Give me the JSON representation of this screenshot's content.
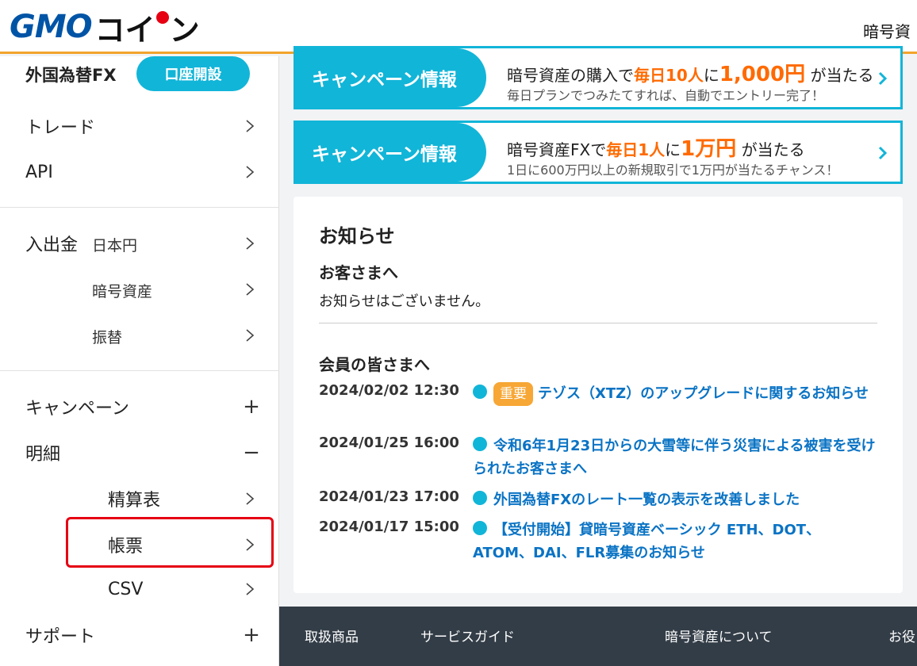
{
  "header": {
    "logo_gmo": "GMO",
    "logo_coin_a": "コイ",
    "logo_coin_b": "ン",
    "nav_cut": "暗号資"
  },
  "sidebar": {
    "fx_title": "外国為替FX",
    "open_account": "口座開設",
    "trade": "トレード",
    "api": "API",
    "deposit": "入出金",
    "deposit_jpy": "日本円",
    "deposit_crypto": "暗号資産",
    "transfer": "振替",
    "campaign": "キャンペーン",
    "statement": "明細",
    "statement_settlement": "精算表",
    "statement_report": "帳票",
    "statement_csv": "CSV",
    "support": "サポート",
    "plus": "+",
    "minus": "−"
  },
  "banners": [
    {
      "tag": "キャンペーン情報",
      "line1_a": "暗号資産の購入で",
      "line1_hl": "毎日10人",
      "line1_b": "に",
      "line1_big": "1,000円",
      "line1_c": "が当たる",
      "line2": "毎日プランでつみたてすれば、自動でエントリー完了！"
    },
    {
      "tag": "キャンペーン情報",
      "line1_a": "暗号資産FXで",
      "line1_hl": "毎日1人",
      "line1_b": "に",
      "line1_big": "1万円",
      "line1_c": "が当たる",
      "line2": "1日に600万円以上の新規取引で1万円が当たるチャンス！"
    }
  ],
  "notices": {
    "title": "お知らせ",
    "customers_heading": "お客さまへ",
    "customers_none": "お知らせはございません。",
    "members_heading": "会員の皆さまへ",
    "items": [
      {
        "date": "2024/02/02 12:30",
        "badge": "重要",
        "text": "テゾス（XTZ）のアップグレードに関するお知らせ"
      },
      {
        "date": "2024/01/25 16:00",
        "text": "令和6年1月23日からの大雪等に伴う災害による被害を受けられたお客さまへ"
      },
      {
        "date": "2024/01/23 17:00",
        "text": "外国為替FXのレート一覧の表示を改善しました"
      },
      {
        "date": "2024/01/17 15:00",
        "text": "【受付開始】貸暗号資産ベーシック ETH、DOT、ATOM、DAI、FLR募集のお知らせ"
      }
    ]
  },
  "footer": {
    "products": "取扱商品",
    "service_guide": "サービスガイド",
    "about_crypto": "暗号資産について",
    "useful_cut": "お役"
  },
  "colors": {
    "accent": "#11b5d8",
    "header_border": "#f3a32c",
    "highlight": "#e60012",
    "link": "#0a73c4",
    "badge": "#f7a735",
    "footer_bg": "#333d47"
  }
}
